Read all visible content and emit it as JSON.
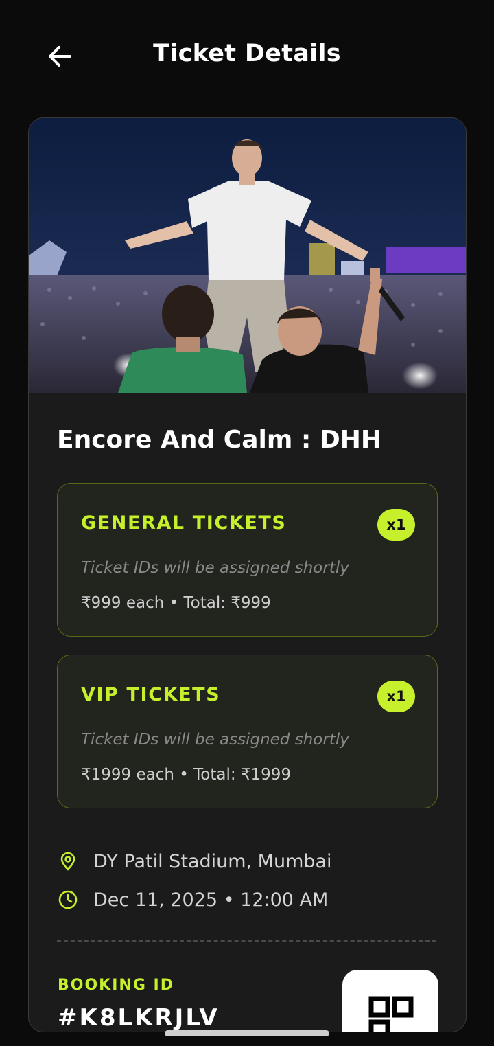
{
  "header": {
    "title": "Ticket Details",
    "back_icon": "arrow-left-icon"
  },
  "event": {
    "name": "Encore And Calm : DHH",
    "image": "concert-crowd-photo"
  },
  "tickets": [
    {
      "type": "GENERAL TICKETS",
      "quantity": "x1",
      "note": "Ticket IDs will be assigned shortly",
      "price_line": "₹999 each • Total: ₹999"
    },
    {
      "type": "VIP TICKETS",
      "quantity": "x1",
      "note": "Ticket IDs will be assigned shortly",
      "price_line": "₹1999 each • Total: ₹1999"
    }
  ],
  "details": {
    "location": "DY Patil Stadium, Mumbai",
    "location_icon": "map-pin-icon",
    "datetime": "Dec 11, 2025 • 12:00 AM",
    "datetime_icon": "clock-icon"
  },
  "booking": {
    "label": "BOOKING ID",
    "id": "#K8LKRJLV",
    "qr_icon": "qr-code-icon"
  },
  "colors": {
    "accent": "#c6f02c",
    "background": "#0b0b0b",
    "card": "#1b1b1b",
    "ticket_box": "#22241e"
  }
}
